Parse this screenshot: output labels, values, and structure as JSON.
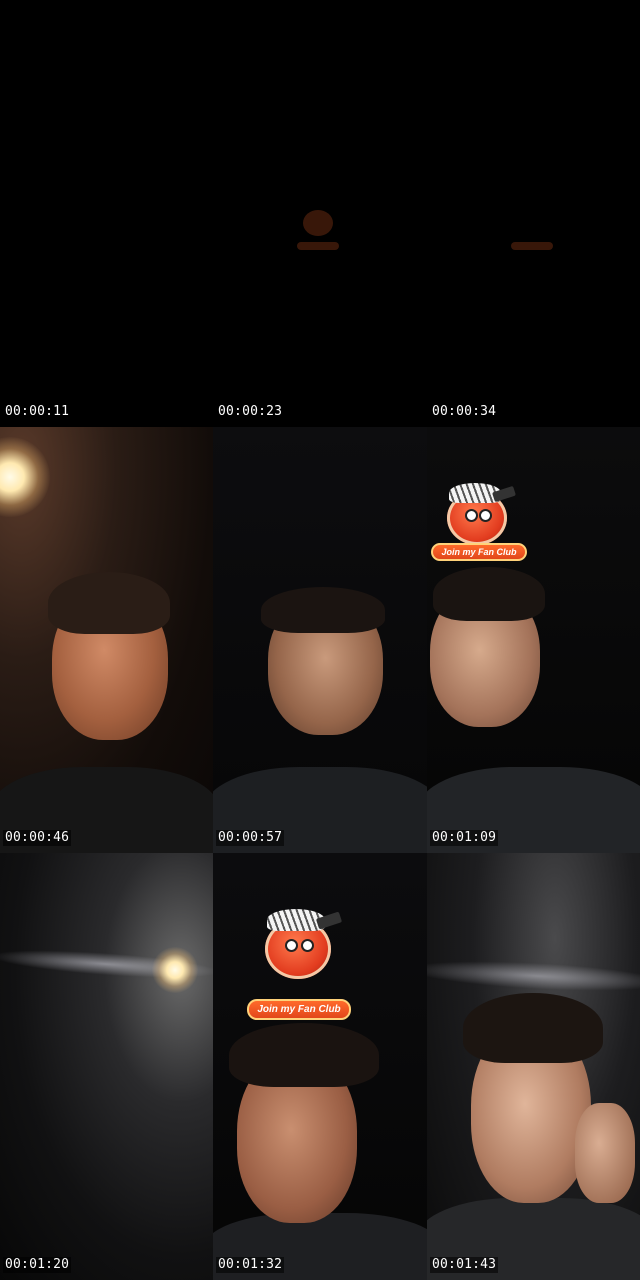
{
  "frames": [
    {
      "timestamp": "00:00:11"
    },
    {
      "timestamp": "00:00:23"
    },
    {
      "timestamp": "00:00:34"
    },
    {
      "timestamp": "00:00:46"
    },
    {
      "timestamp": "00:00:57"
    },
    {
      "timestamp": "00:01:09",
      "badge_label": "Join my Fan Club"
    },
    {
      "timestamp": "00:01:20"
    },
    {
      "timestamp": "00:01:32",
      "badge_label": "Join my Fan Club"
    },
    {
      "timestamp": "00:01:43"
    }
  ],
  "colors": {
    "background": "#000000",
    "badge_orange": "#e2471b",
    "badge_border": "#ffd27a"
  }
}
